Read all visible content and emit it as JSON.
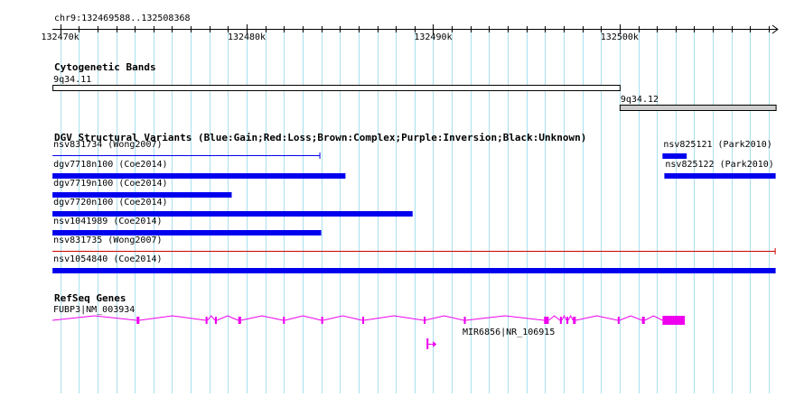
{
  "ruler": {
    "location": "chr9:132469588..132508368",
    "ticks": [
      {
        "pos": 132470000,
        "label": "132470k"
      },
      {
        "pos": 132480000,
        "label": "132480k"
      },
      {
        "pos": 132490000,
        "label": "132490k"
      },
      {
        "pos": 132500000,
        "label": "132500k"
      }
    ]
  },
  "colors": {
    "gridline": "#aadfee",
    "gain": "#0000ee",
    "loss": "#cc0000",
    "gene": "#ee00ee",
    "band_light": "#ffffff",
    "band_gray": "#cccccc"
  },
  "tracks": {
    "cytoband": {
      "title": "Cytogenetic Bands",
      "bands": [
        {
          "name": "9q34.11",
          "start": 132469588,
          "end": 132500000,
          "stain": "gneg"
        },
        {
          "name": "9q34.12",
          "start": 132500000,
          "end": 132508368,
          "stain": "gpos"
        }
      ]
    },
    "dgv": {
      "title": "DGV Structural Variants (Blue:Gain;Red:Loss;Brown:Complex;Purple:Inversion;Black:Unknown)",
      "variants": [
        {
          "name": "nsv831734 (Wong2007)",
          "start": 132469588,
          "end": 132483950,
          "type": "gain",
          "style": "thin"
        },
        {
          "name": "dgv7718n100 (Coe2014)",
          "start": 132469588,
          "end": 132485300,
          "type": "gain",
          "style": "thick"
        },
        {
          "name": "dgv7719n100 (Coe2014)",
          "start": 132469588,
          "end": 132479200,
          "type": "gain",
          "style": "thick"
        },
        {
          "name": "dgv7720n100 (Coe2014)",
          "start": 132469588,
          "end": 132488900,
          "type": "gain",
          "style": "thick"
        },
        {
          "name": "nsv1041989 (Coe2014)",
          "start": 132469588,
          "end": 132484000,
          "type": "gain",
          "style": "thick"
        },
        {
          "name": "nsv831735 (Wong2007)",
          "start": 132469588,
          "end": 132508368,
          "type": "loss",
          "style": "thin"
        },
        {
          "name": "nsv1054840 (Coe2014)",
          "start": 132469588,
          "end": 132508368,
          "type": "gain",
          "style": "thick"
        },
        {
          "name": "nsv825121 (Park2010)",
          "start": 132502300,
          "end": 132503600,
          "type": "gain",
          "style": "thick"
        },
        {
          "name": "nsv825122 (Park2010)",
          "start": 132502400,
          "end": 132508368,
          "type": "gain",
          "style": "thick"
        }
      ]
    },
    "refseq": {
      "title": "RefSeq Genes",
      "genes": [
        {
          "name": "FUBP3|NM_003934",
          "start": 132469588,
          "end": 132503500,
          "exons": [
            [
              132474100,
              132474250
            ],
            [
              132477800,
              132477900
            ],
            [
              132478300,
              132478400
            ],
            [
              132479550,
              132479700
            ],
            [
              132481950,
              132482050
            ],
            [
              132484000,
              132484100
            ],
            [
              132486200,
              132486300
            ],
            [
              132489500,
              132489550
            ],
            [
              132491650,
              132491750
            ],
            [
              132495950,
              132496200
            ],
            [
              132496800,
              132496900
            ],
            [
              132497150,
              132497250
            ],
            [
              132497500,
              132497650
            ],
            [
              132499900,
              132500000
            ],
            [
              132501200,
              132501350
            ],
            [
              132502300,
              132503500
            ]
          ]
        },
        {
          "name": "MIR6856|NR_106915",
          "start": 132489650,
          "end": 132490200,
          "exons": [
            [
              132489650,
              132489750
            ]
          ]
        }
      ]
    }
  }
}
